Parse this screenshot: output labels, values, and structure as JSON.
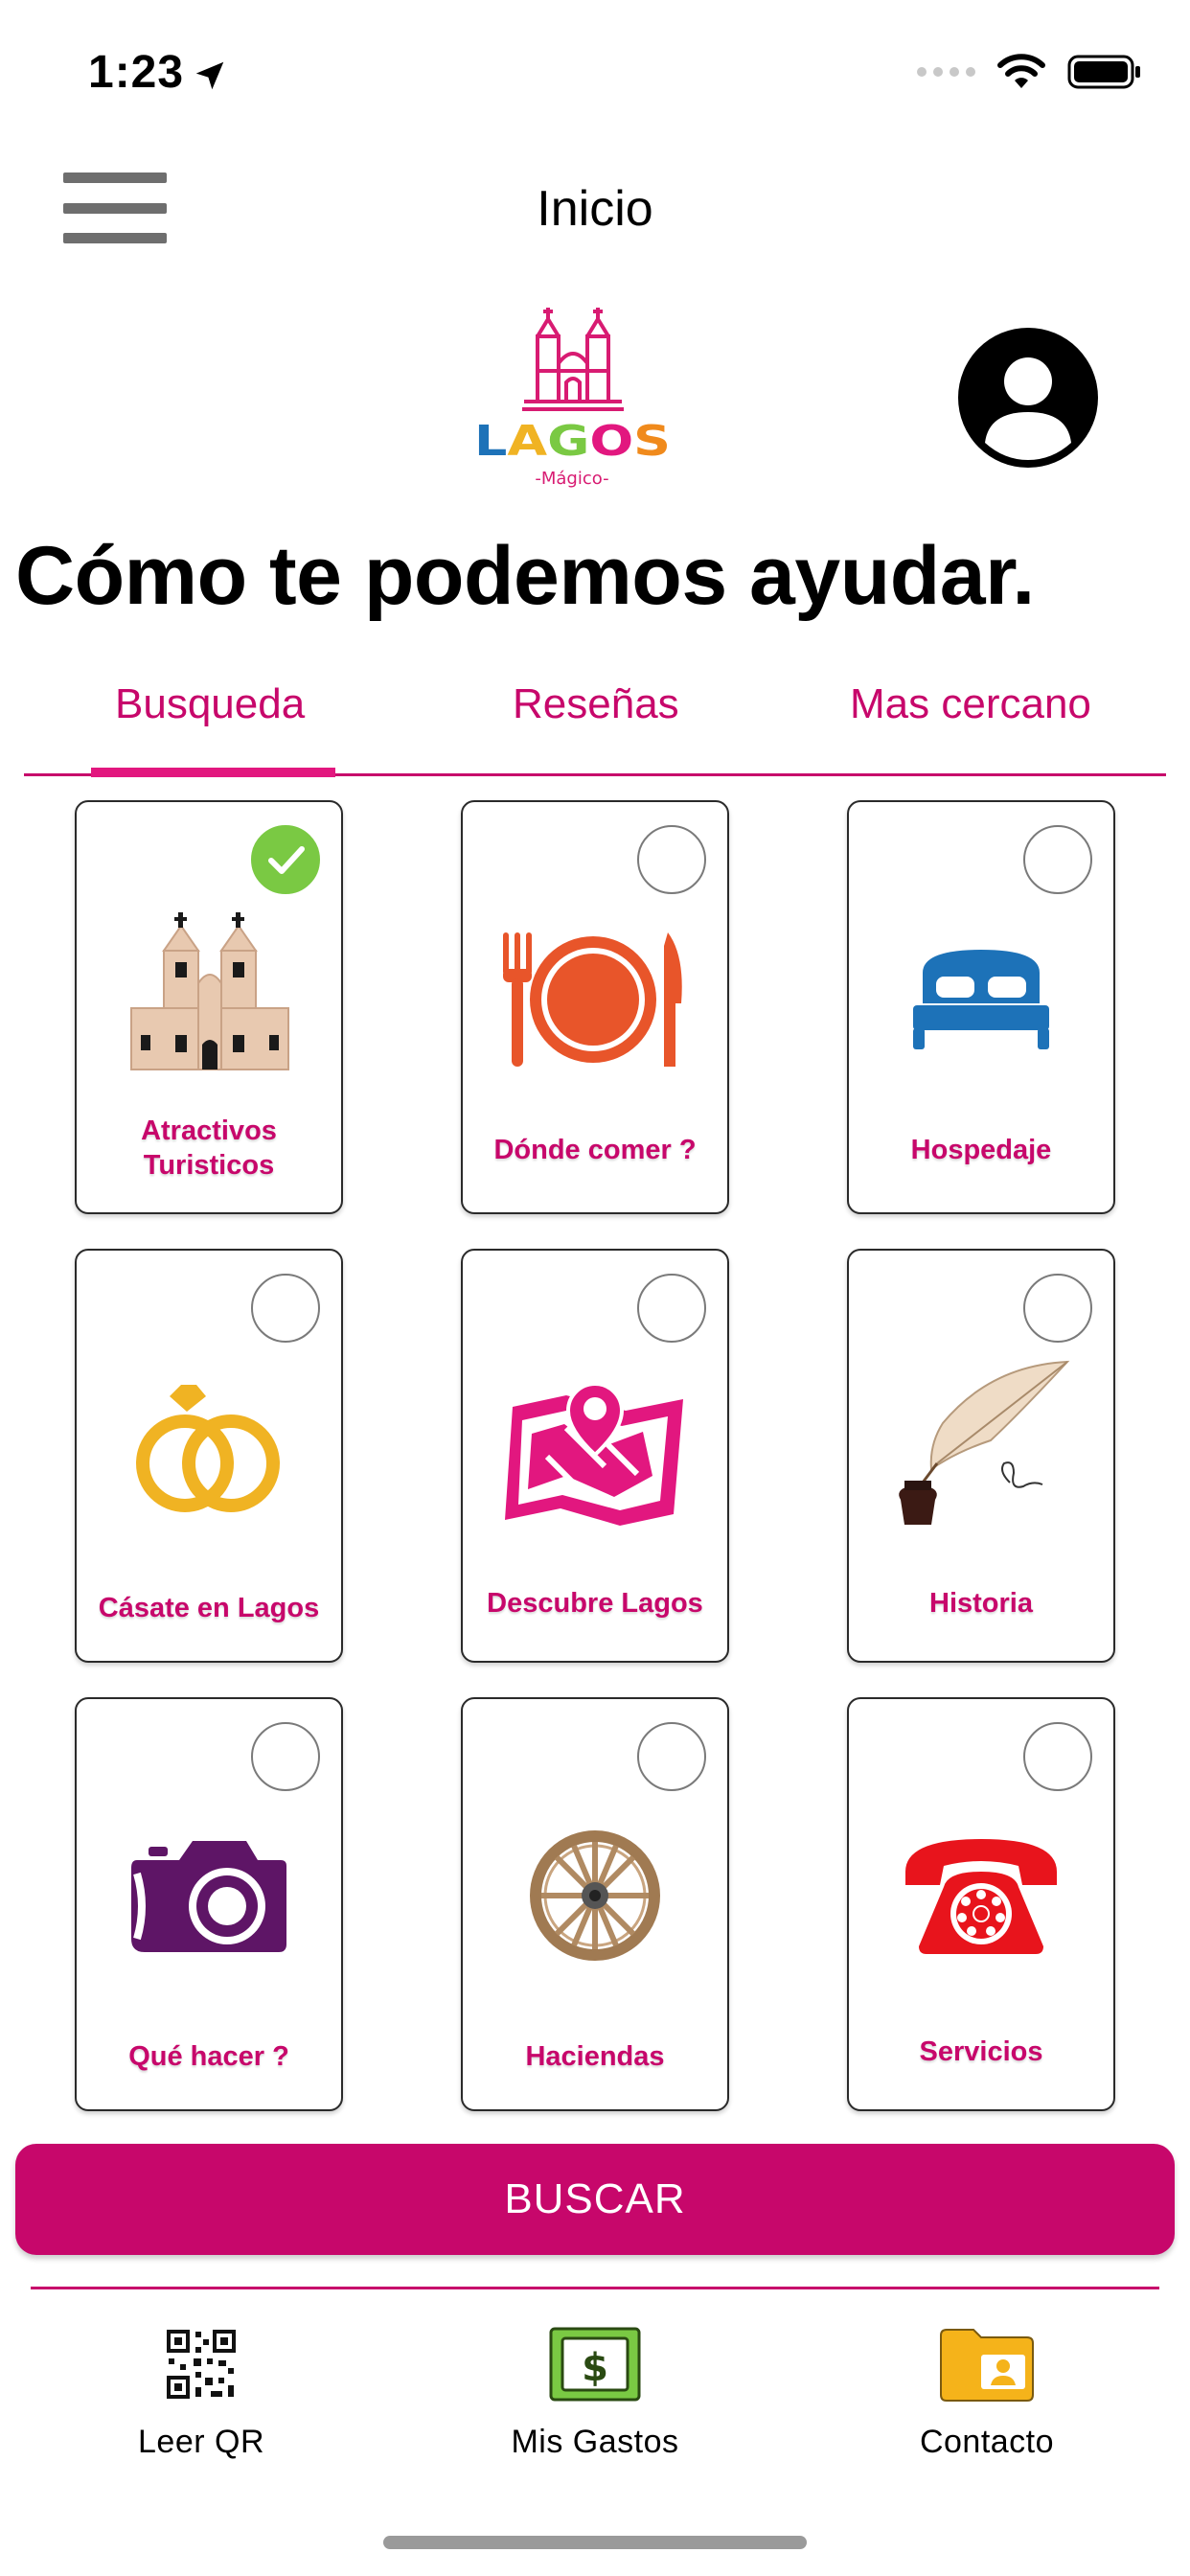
{
  "status_bar": {
    "time": "1:23"
  },
  "nav": {
    "title": "Inicio"
  },
  "logo": {
    "word": "LAGOS",
    "subtitle": "-Mágico-"
  },
  "headline": "Cómo te podemos ayudar.",
  "tabs": [
    {
      "label": "Busqueda",
      "selected": true
    },
    {
      "label": "Reseñas",
      "selected": false
    },
    {
      "label": "Mas cercano",
      "selected": false
    }
  ],
  "categories": [
    {
      "label": "Atractivos Turisticos",
      "icon": "cathedral-icon",
      "checked": true
    },
    {
      "label": "Dónde comer ?",
      "icon": "plate-cutlery-icon",
      "checked": false
    },
    {
      "label": "Hospedaje",
      "icon": "bed-icon",
      "checked": false
    },
    {
      "label": "Cásate en Lagos",
      "icon": "wedding-rings-icon",
      "checked": false
    },
    {
      "label": "Descubre Lagos",
      "icon": "map-pin-icon",
      "checked": false
    },
    {
      "label": "Historia",
      "icon": "quill-inkwell-icon",
      "checked": false
    },
    {
      "label": "Qué hacer ?",
      "icon": "camera-icon",
      "checked": false
    },
    {
      "label": "Haciendas",
      "icon": "wagon-wheel-icon",
      "checked": false
    },
    {
      "label": "Servicios",
      "icon": "telephone-icon",
      "checked": false
    }
  ],
  "search_button": "BUSCAR",
  "bottom_tabs": [
    {
      "label": "Leer QR",
      "icon": "qr-code-icon"
    },
    {
      "label": "Mis Gastos",
      "icon": "money-icon"
    },
    {
      "label": "Contacto",
      "icon": "contact-folder-icon"
    }
  ],
  "colors": {
    "brand": "#c7076b",
    "check_green": "#7ac943",
    "bed_blue": "#1d72b8",
    "plate_orange": "#e8552a",
    "ring_gold": "#f0b323",
    "map_pink": "#e2177f",
    "camera_purple": "#5e1566",
    "phone_red": "#e8141c"
  }
}
